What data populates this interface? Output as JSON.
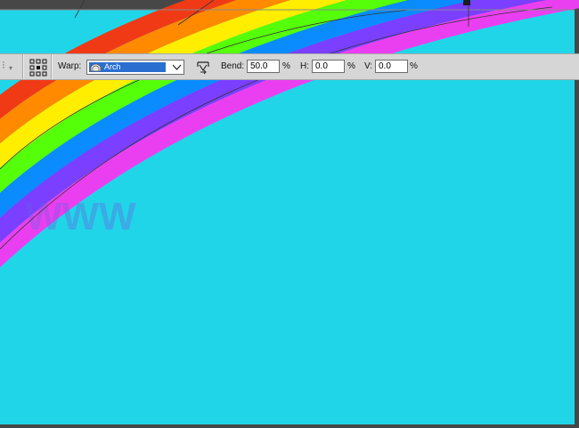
{
  "options_bar": {
    "warp_label": "Warp:",
    "warp_style": "Arch",
    "bend_label": "Bend:",
    "bend_value": "50.0",
    "h_label": "H:",
    "h_value": "0.0",
    "v_label": "V:",
    "v_value": "0.0",
    "percent": "%"
  },
  "canvas": {
    "background": "#21d5e8",
    "pasteboard": "#474747",
    "rainbow_bands": [
      "#f03a16",
      "#ff8a00",
      "#ffee00",
      "#55ff0a",
      "#0a8cff",
      "#7a3fff",
      "#ea3ff0"
    ],
    "watermark": "WWW"
  }
}
